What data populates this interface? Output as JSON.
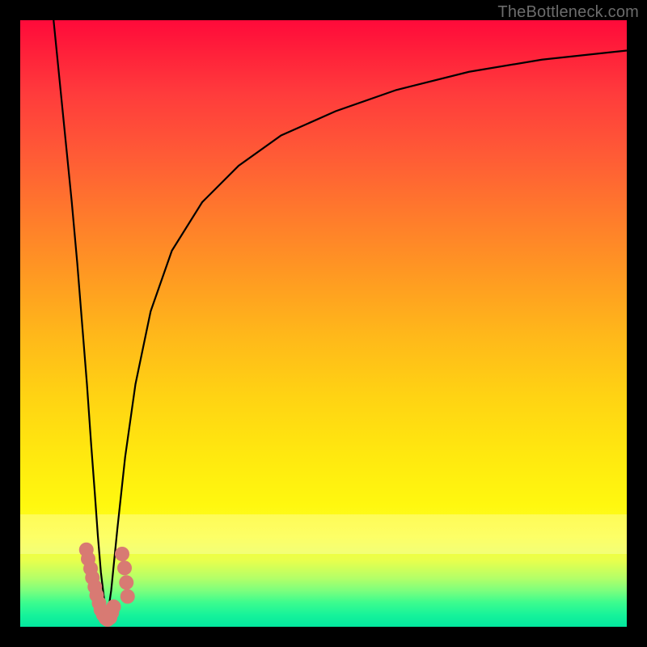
{
  "watermark": "TheBottleneck.com",
  "chart_data": {
    "type": "line",
    "title": "",
    "xlabel": "",
    "ylabel": "",
    "xlim": [
      0,
      100
    ],
    "ylim": [
      0,
      100
    ],
    "grid": false,
    "legend": false,
    "series": [
      {
        "name": "left-branch",
        "x": [
          5.5,
          6.5,
          7.5,
          8.5,
          9.4,
          10.2,
          11.0,
          11.7,
          12.3,
          12.8,
          13.3,
          13.9,
          14.3
        ],
        "y": [
          100,
          90,
          80,
          70,
          60,
          50,
          40,
          30,
          22,
          15,
          9,
          4,
          1.2
        ]
      },
      {
        "name": "right-branch",
        "x": [
          14.3,
          15.0,
          16.0,
          17.3,
          19.0,
          21.5,
          25.0,
          30.0,
          36.0,
          43.0,
          52.0,
          62.0,
          74.0,
          86.0,
          100.0
        ],
        "y": [
          1.2,
          6,
          16,
          28,
          40,
          52,
          62,
          70,
          76,
          81,
          85,
          88.5,
          91.5,
          93.5,
          95.0
        ]
      }
    ],
    "markers": [
      {
        "name": "cluster-dot",
        "x": 10.9,
        "y": 12.7
      },
      {
        "name": "cluster-dot",
        "x": 11.2,
        "y": 11.2
      },
      {
        "name": "cluster-dot",
        "x": 11.6,
        "y": 9.6
      },
      {
        "name": "cluster-dot",
        "x": 11.9,
        "y": 8.1
      },
      {
        "name": "cluster-dot",
        "x": 12.3,
        "y": 6.6
      },
      {
        "name": "cluster-dot",
        "x": 12.6,
        "y": 5.2
      },
      {
        "name": "cluster-dot",
        "x": 13.0,
        "y": 3.9
      },
      {
        "name": "cluster-dot",
        "x": 13.3,
        "y": 2.8
      },
      {
        "name": "cluster-dot",
        "x": 13.7,
        "y": 2.0
      },
      {
        "name": "cluster-dot",
        "x": 14.1,
        "y": 1.4
      },
      {
        "name": "cluster-dot",
        "x": 14.4,
        "y": 1.2
      },
      {
        "name": "cluster-dot",
        "x": 14.8,
        "y": 1.5
      },
      {
        "name": "cluster-dot",
        "x": 15.1,
        "y": 2.3
      },
      {
        "name": "cluster-dot",
        "x": 15.4,
        "y": 3.3
      },
      {
        "name": "cluster-dot",
        "x": 16.8,
        "y": 12.0
      },
      {
        "name": "cluster-dot",
        "x": 17.2,
        "y": 9.7
      },
      {
        "name": "cluster-dot",
        "x": 17.5,
        "y": 7.3
      },
      {
        "name": "cluster-dot",
        "x": 17.7,
        "y": 5.0
      }
    ],
    "marker_radius_px": 9,
    "background": "rainbow-vertical-gradient"
  }
}
